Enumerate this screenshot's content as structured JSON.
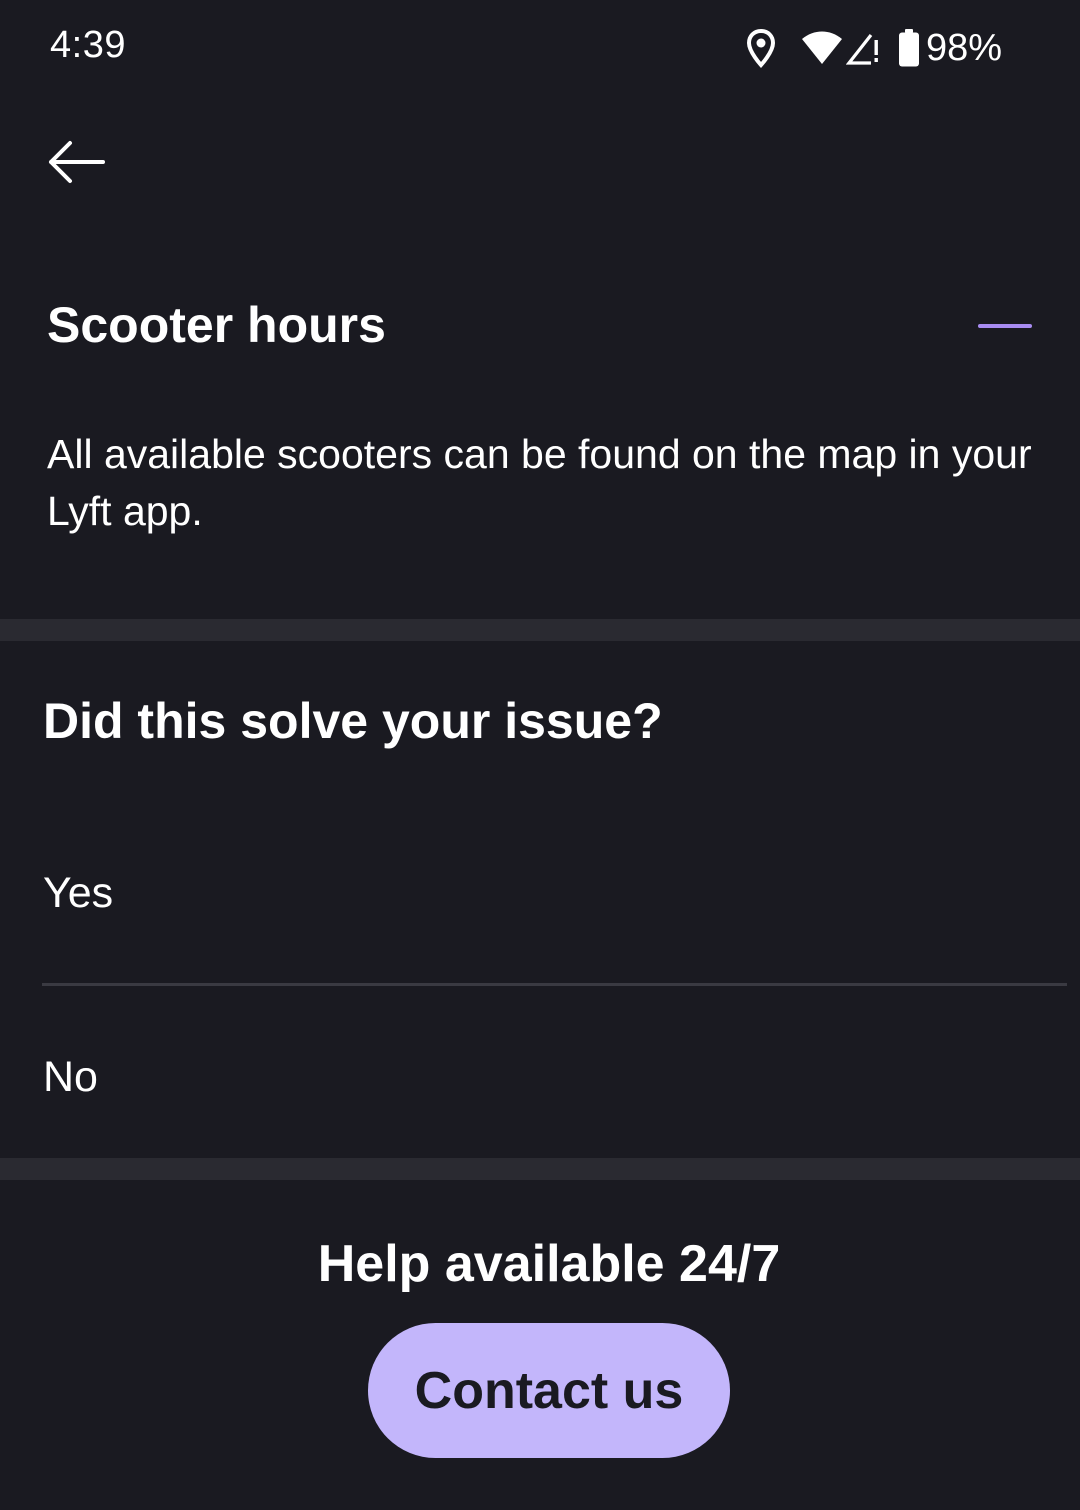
{
  "status_bar": {
    "time": "4:39",
    "battery_percent": "98%",
    "icons": [
      "location-icon",
      "wifi-icon",
      "cell-signal-no-data-icon",
      "battery-icon"
    ]
  },
  "header": {
    "back_icon": "back-arrow-icon"
  },
  "faq": {
    "title": "Scooter hours",
    "expanded": true,
    "toggle_icon": "collapse-minus-icon",
    "body": "All available scooters can be found on the map in your Lyft app."
  },
  "feedback": {
    "question": "Did this solve your issue?",
    "options": [
      "Yes",
      "No"
    ]
  },
  "help": {
    "title": "Help available 24/7",
    "button_label": "Contact us"
  },
  "colors": {
    "background": "#1a1a21",
    "divider": "#2a2a31",
    "accent": "#a88cf2",
    "button": "#c3b6fb",
    "text": "#ffffff"
  }
}
